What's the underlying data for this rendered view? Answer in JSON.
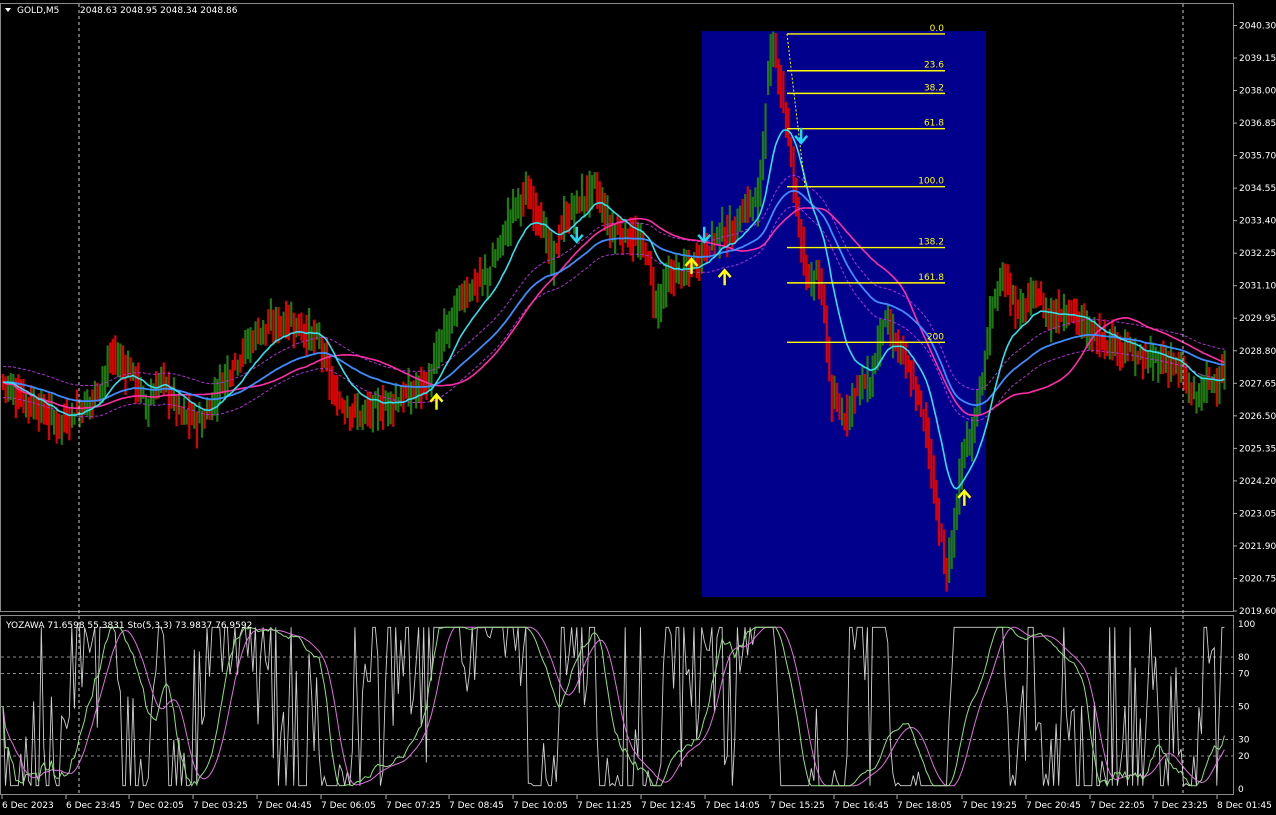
{
  "header": {
    "symbol": "GOLD,M5",
    "ohlc": "2048.63 2048.95 2048.34 2048.86"
  },
  "indicator_header": {
    "text": "YOZAWA 71.6598 55.3831  Sto(5,3,3) 73.9837 76.9592"
  },
  "colors": {
    "background": "#000000",
    "bull_bar": "#1f7a12",
    "bear_bar": "#e00000",
    "fib_box": "#00008c",
    "fib_line": "#ffff00",
    "ma_cyan": "#33e0ee",
    "ma_blue": "#3f8cff",
    "ma_pink": "#ff2ea8",
    "env_purple": "#b030d8",
    "arrow_up": "#ffff00",
    "arrow_down": "#22d8ee",
    "sto_white": "#d0d0d0",
    "sto_green": "#90e080",
    "sto_pink": "#e070e0"
  },
  "icons": {
    "buy": "arrow-up-icon",
    "sell": "arrow-down-icon"
  },
  "chart_data": [
    {
      "type": "bar",
      "symbol": "GOLD,M5",
      "ylim": [
        2019.6,
        2040.6
      ],
      "y_ticks": [
        "2040.30",
        "2039.15",
        "2038.00",
        "2036.85",
        "2035.70",
        "2034.55",
        "2033.40",
        "2032.25",
        "2031.10",
        "2029.95",
        "2028.80",
        "2027.65",
        "2026.50",
        "2025.35",
        "2024.20",
        "2023.05",
        "2021.90",
        "2020.75",
        "2019.60"
      ],
      "x_ticks": [
        "6 Dec 2023",
        "6 Dec 23:45",
        "7 Dec 02:05",
        "7 Dec 03:25",
        "7 Dec 04:45",
        "7 Dec 06:05",
        "7 Dec 07:25",
        "7 Dec 08:45",
        "7 Dec 10:05",
        "7 Dec 11:25",
        "7 Dec 12:45",
        "7 Dec 14:05",
        "7 Dec 15:25",
        "7 Dec 16:45",
        "7 Dec 18:05",
        "7 Dec 19:25",
        "7 Dec 20:45",
        "7 Dec 22:05",
        "7 Dec 23:25",
        "8 Dec 01:45"
      ],
      "price_path": [
        [
          0,
          2027.7
        ],
        [
          8,
          2027.1
        ],
        [
          15,
          2026.7
        ],
        [
          22,
          2026.2
        ],
        [
          30,
          2026.8
        ],
        [
          35,
          2027.1
        ],
        [
          43,
          2028.6
        ],
        [
          50,
          2028.1
        ],
        [
          56,
          2026.9
        ],
        [
          62,
          2027.8
        ],
        [
          70,
          2026.5
        ],
        [
          78,
          2026.3
        ],
        [
          86,
          2027.8
        ],
        [
          94,
          2028.8
        ],
        [
          100,
          2029.5
        ],
        [
          112,
          2029.9
        ],
        [
          124,
          2029.1
        ],
        [
          130,
          2027.1
        ],
        [
          140,
          2026.5
        ],
        [
          150,
          2026.9
        ],
        [
          160,
          2027.3
        ],
        [
          167,
          2027.8
        ],
        [
          172,
          2029.2
        ],
        [
          180,
          2030.8
        ],
        [
          190,
          2031.5
        ],
        [
          195,
          2032.6
        ],
        [
          200,
          2033.9
        ],
        [
          205,
          2034.3
        ],
        [
          210,
          2033.6
        ],
        [
          215,
          2032.0
        ],
        [
          220,
          2033.4
        ],
        [
          225,
          2034.0
        ],
        [
          232,
          2034.6
        ],
        [
          238,
          2033.1
        ],
        [
          245,
          2032.9
        ],
        [
          252,
          2032.3
        ],
        [
          256,
          2030.4
        ],
        [
          262,
          2031.5
        ],
        [
          268,
          2031.6
        ],
        [
          275,
          2032.4
        ],
        [
          282,
          2033.1
        ],
        [
          286,
          2032.9
        ],
        [
          290,
          2033.8
        ],
        [
          296,
          2034.2
        ],
        [
          300,
          2038.6
        ],
        [
          302,
          2039.4
        ],
        [
          305,
          2038.2
        ],
        [
          308,
          2036.2
        ],
        [
          312,
          2033.3
        ],
        [
          316,
          2031.0
        ],
        [
          319,
          2031.6
        ],
        [
          322,
          2030.0
        ],
        [
          325,
          2027.0
        ],
        [
          330,
          2026.5
        ],
        [
          335,
          2027.6
        ],
        [
          340,
          2027.7
        ],
        [
          345,
          2029.9
        ],
        [
          352,
          2028.7
        ],
        [
          358,
          2027.3
        ],
        [
          362,
          2026.0
        ],
        [
          366,
          2023.2
        ],
        [
          370,
          2020.8
        ],
        [
          373,
          2022.8
        ],
        [
          376,
          2025.0
        ],
        [
          380,
          2026.0
        ],
        [
          384,
          2028.0
        ],
        [
          388,
          2030.5
        ],
        [
          393,
          2031.4
        ],
        [
          398,
          2030.1
        ],
        [
          405,
          2030.8
        ],
        [
          410,
          2030.0
        ],
        [
          418,
          2030.3
        ],
        [
          425,
          2029.5
        ],
        [
          432,
          2029.2
        ],
        [
          440,
          2028.9
        ],
        [
          447,
          2028.4
        ],
        [
          452,
          2028.5
        ],
        [
          458,
          2028.4
        ],
        [
          463,
          2027.8
        ],
        [
          467,
          2027.1
        ],
        [
          472,
          2027.6
        ],
        [
          477,
          2027.9
        ],
        [
          480,
          2028.2
        ]
      ],
      "fibonacci_levels": [
        {
          "label": "0.0",
          "price": 2040.0
        },
        {
          "label": "23.6",
          "price": 2038.7
        },
        {
          "label": "38.2",
          "price": 2037.9
        },
        {
          "label": "61.8",
          "price": 2036.65
        },
        {
          "label": "100.0",
          "price": 2034.6
        },
        {
          "label": "138.2",
          "price": 2032.45
        },
        {
          "label": "161.8",
          "price": 2031.2
        },
        {
          "label": "200",
          "price": 2029.1
        }
      ],
      "signals": [
        {
          "type": "buy",
          "bar": 170,
          "price": 2027.0
        },
        {
          "type": "sell",
          "bar": 225,
          "price": 2032.9
        },
        {
          "type": "buy",
          "bar": 270,
          "price": 2031.8
        },
        {
          "type": "sell",
          "bar": 275,
          "price": 2032.9
        },
        {
          "type": "buy",
          "bar": 283,
          "price": 2031.4
        },
        {
          "type": "sell",
          "bar": 313,
          "price": 2036.4
        },
        {
          "type": "buy",
          "bar": 377,
          "price": 2023.6
        }
      ]
    },
    {
      "type": "line",
      "title": "YOZAWA 71.6598 55.3831  Sto(5,3,3) 73.9837 76.9592",
      "ylim": [
        0,
        100
      ],
      "y_ticks": [
        "100",
        "80",
        "70",
        "50",
        "30",
        "20",
        "0"
      ],
      "levels": [
        80,
        70,
        50,
        30,
        20
      ],
      "last_values": [
        71.6598,
        55.3831,
        73.9837,
        76.9592
      ]
    }
  ]
}
